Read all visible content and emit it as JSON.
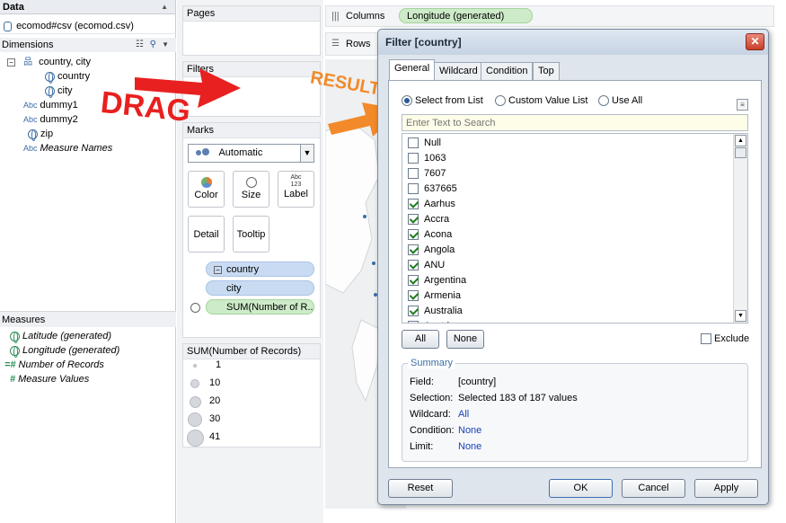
{
  "data_pane": {
    "header": "Data",
    "datasource": "ecomod#csv (ecomod.csv)",
    "dimensions_header": "Dimensions",
    "dimensions": [
      {
        "label": "country, city",
        "icon": "hierarchy-icon"
      },
      {
        "label": "country",
        "icon": "globe-icon"
      },
      {
        "label": "city",
        "icon": "globe-icon"
      },
      {
        "label": "dummy1",
        "icon": "abc-icon"
      },
      {
        "label": "dummy2",
        "icon": "abc-icon"
      },
      {
        "label": "zip",
        "icon": "globe-icon"
      },
      {
        "label": "Measure Names",
        "icon": "abc-icon"
      }
    ],
    "measures_header": "Measures",
    "measures": [
      {
        "label": "Latitude (generated)",
        "icon": "globe-icon"
      },
      {
        "label": "Longitude (generated)",
        "icon": "globe-icon"
      },
      {
        "label": "Number of Records",
        "icon": "hash-icon"
      },
      {
        "label": "Measure Values",
        "icon": "hash-icon"
      }
    ]
  },
  "shelves": {
    "pages": "Pages",
    "filters": "Filters",
    "marks": "Marks",
    "marks_type": "Automatic",
    "mark_buttons": {
      "color": "Color",
      "size": "Size",
      "label": "Label",
      "label_icon": "Abc\n123",
      "detail": "Detail",
      "tooltip": "Tooltip"
    },
    "pills": {
      "country": "country",
      "city": "city",
      "sum": "SUM(Number of R..."
    },
    "size_legend": {
      "title": "SUM(Number of Records)",
      "values": [
        "1",
        "10",
        "20",
        "30",
        "41"
      ]
    },
    "columns_label": "Columns",
    "columns_pill": "Longitude (generated)",
    "rows_label": "Rows"
  },
  "annotations": {
    "drag": "DRAG",
    "result": "RESULT",
    "colors": {
      "arrow_red": "#e8201f",
      "arrow_orange": "#f28a2a"
    }
  },
  "dialog": {
    "title": "Filter [country]",
    "tabs": [
      "General",
      "Wildcard",
      "Condition",
      "Top"
    ],
    "radio": {
      "select_from_list": "Select from List",
      "custom_value_list": "Custom Value List",
      "use_all": "Use All"
    },
    "search_placeholder": "Enter Text to Search",
    "items": [
      {
        "label": "Null",
        "checked": false
      },
      {
        "label": "1063",
        "checked": false
      },
      {
        "label": "7607",
        "checked": false
      },
      {
        "label": "637665",
        "checked": false
      },
      {
        "label": "Aarhus",
        "checked": true
      },
      {
        "label": "Accra",
        "checked": true
      },
      {
        "label": "Acona",
        "checked": true
      },
      {
        "label": "Angola",
        "checked": true
      },
      {
        "label": "ANU",
        "checked": true
      },
      {
        "label": "Argentina",
        "checked": true
      },
      {
        "label": "Armenia",
        "checked": true
      },
      {
        "label": "Australia",
        "checked": true
      },
      {
        "label": "Austria",
        "checked": true
      }
    ],
    "all_button": "All",
    "none_button": "None",
    "exclude": "Exclude",
    "summary": {
      "title": "Summary",
      "field_label": "Field:",
      "field_value": "[country]",
      "selection_label": "Selection:",
      "selection_value": "Selected 183 of 187 values",
      "wildcard_label": "Wildcard:",
      "wildcard_value": "All",
      "condition_label": "Condition:",
      "condition_value": "None",
      "limit_label": "Limit:",
      "limit_value": "None"
    },
    "buttons": {
      "reset": "Reset",
      "ok": "OK",
      "cancel": "Cancel",
      "apply": "Apply"
    }
  }
}
